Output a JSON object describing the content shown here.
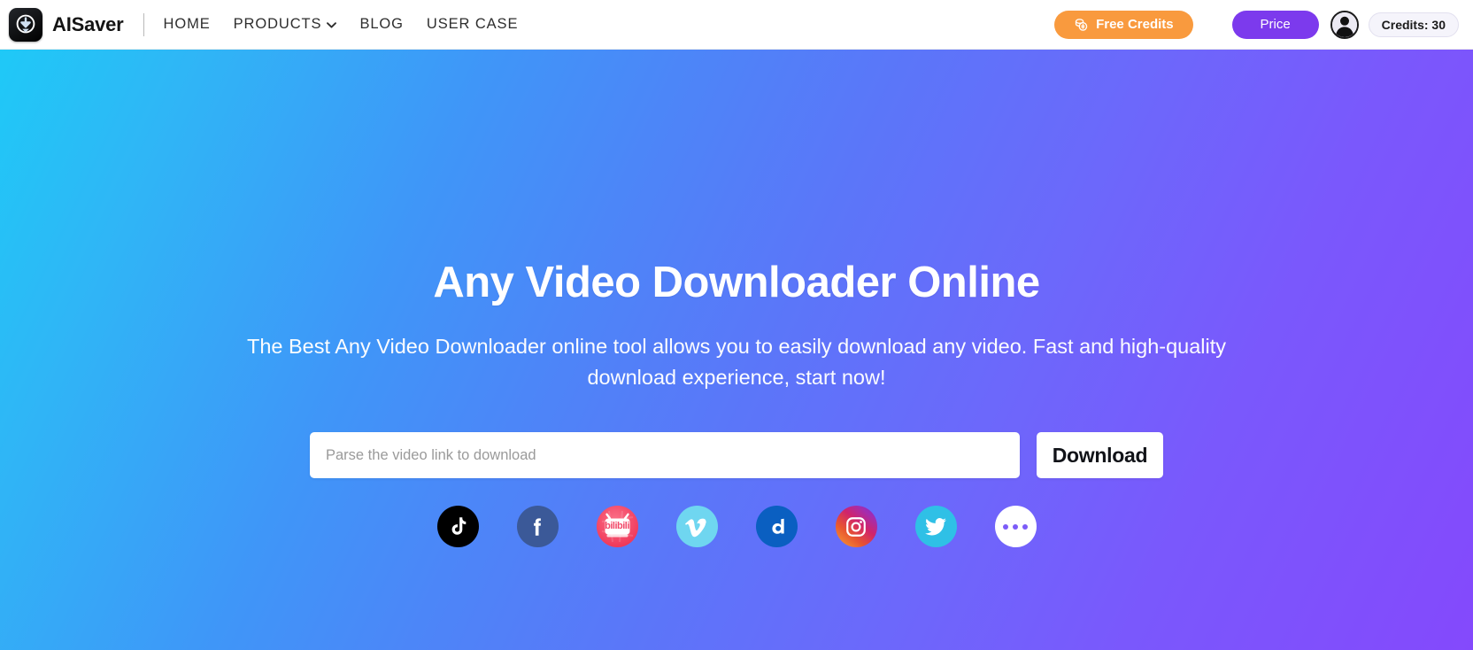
{
  "header": {
    "brand_name": "AISaver",
    "logo_icon": "download-arrow-logo-icon",
    "nav": [
      {
        "label": "HOME",
        "icon": null
      },
      {
        "label": "PRODUCTS",
        "icon": "chevron-down-icon"
      },
      {
        "label": "BLOG",
        "icon": null
      },
      {
        "label": "USER CASE",
        "icon": null
      }
    ],
    "free_credits_label": "Free Credits",
    "free_credits_icon": "coins-icon",
    "free_credits_color": "#F99A3E",
    "price_label": "Price",
    "price_color": "#7C3AED",
    "avatar_icon": "user-avatar-icon",
    "credits_label": "Credits: 30"
  },
  "hero": {
    "title": "Any Video Downloader Online",
    "subtitle": "The Best Any Video Downloader online tool allows you to easily download any video. Fast and high-quality download experience, start now!",
    "gradient_from": "#1FC9F7",
    "gradient_to": "#8449FC",
    "search": {
      "placeholder": "Parse the video link to download",
      "value": "",
      "download_label": "Download"
    },
    "platforms": [
      {
        "name": "tiktok",
        "label": "TikTok",
        "icon": "tiktok-icon",
        "color": "#000000"
      },
      {
        "name": "facebook",
        "label": "Facebook",
        "icon": "facebook-icon",
        "color": "#3B5998"
      },
      {
        "name": "bilibili",
        "label": "bilibili",
        "icon": "bilibili-icon",
        "color": "#F24A6A"
      },
      {
        "name": "vimeo",
        "label": "Vimeo",
        "icon": "vimeo-icon",
        "color": "#6FD6F0"
      },
      {
        "name": "dailymotion",
        "label": "Dailymotion",
        "icon": "dailymotion-icon",
        "color": "#0A5FC1"
      },
      {
        "name": "instagram",
        "label": "Instagram",
        "icon": "instagram-icon",
        "color": "#D0246B"
      },
      {
        "name": "twitter",
        "label": "Twitter",
        "icon": "twitter-icon",
        "color": "#2FC0E6"
      },
      {
        "name": "more",
        "label": "More",
        "icon": "more-dots-icon",
        "color": "#FFFFFF"
      }
    ]
  }
}
